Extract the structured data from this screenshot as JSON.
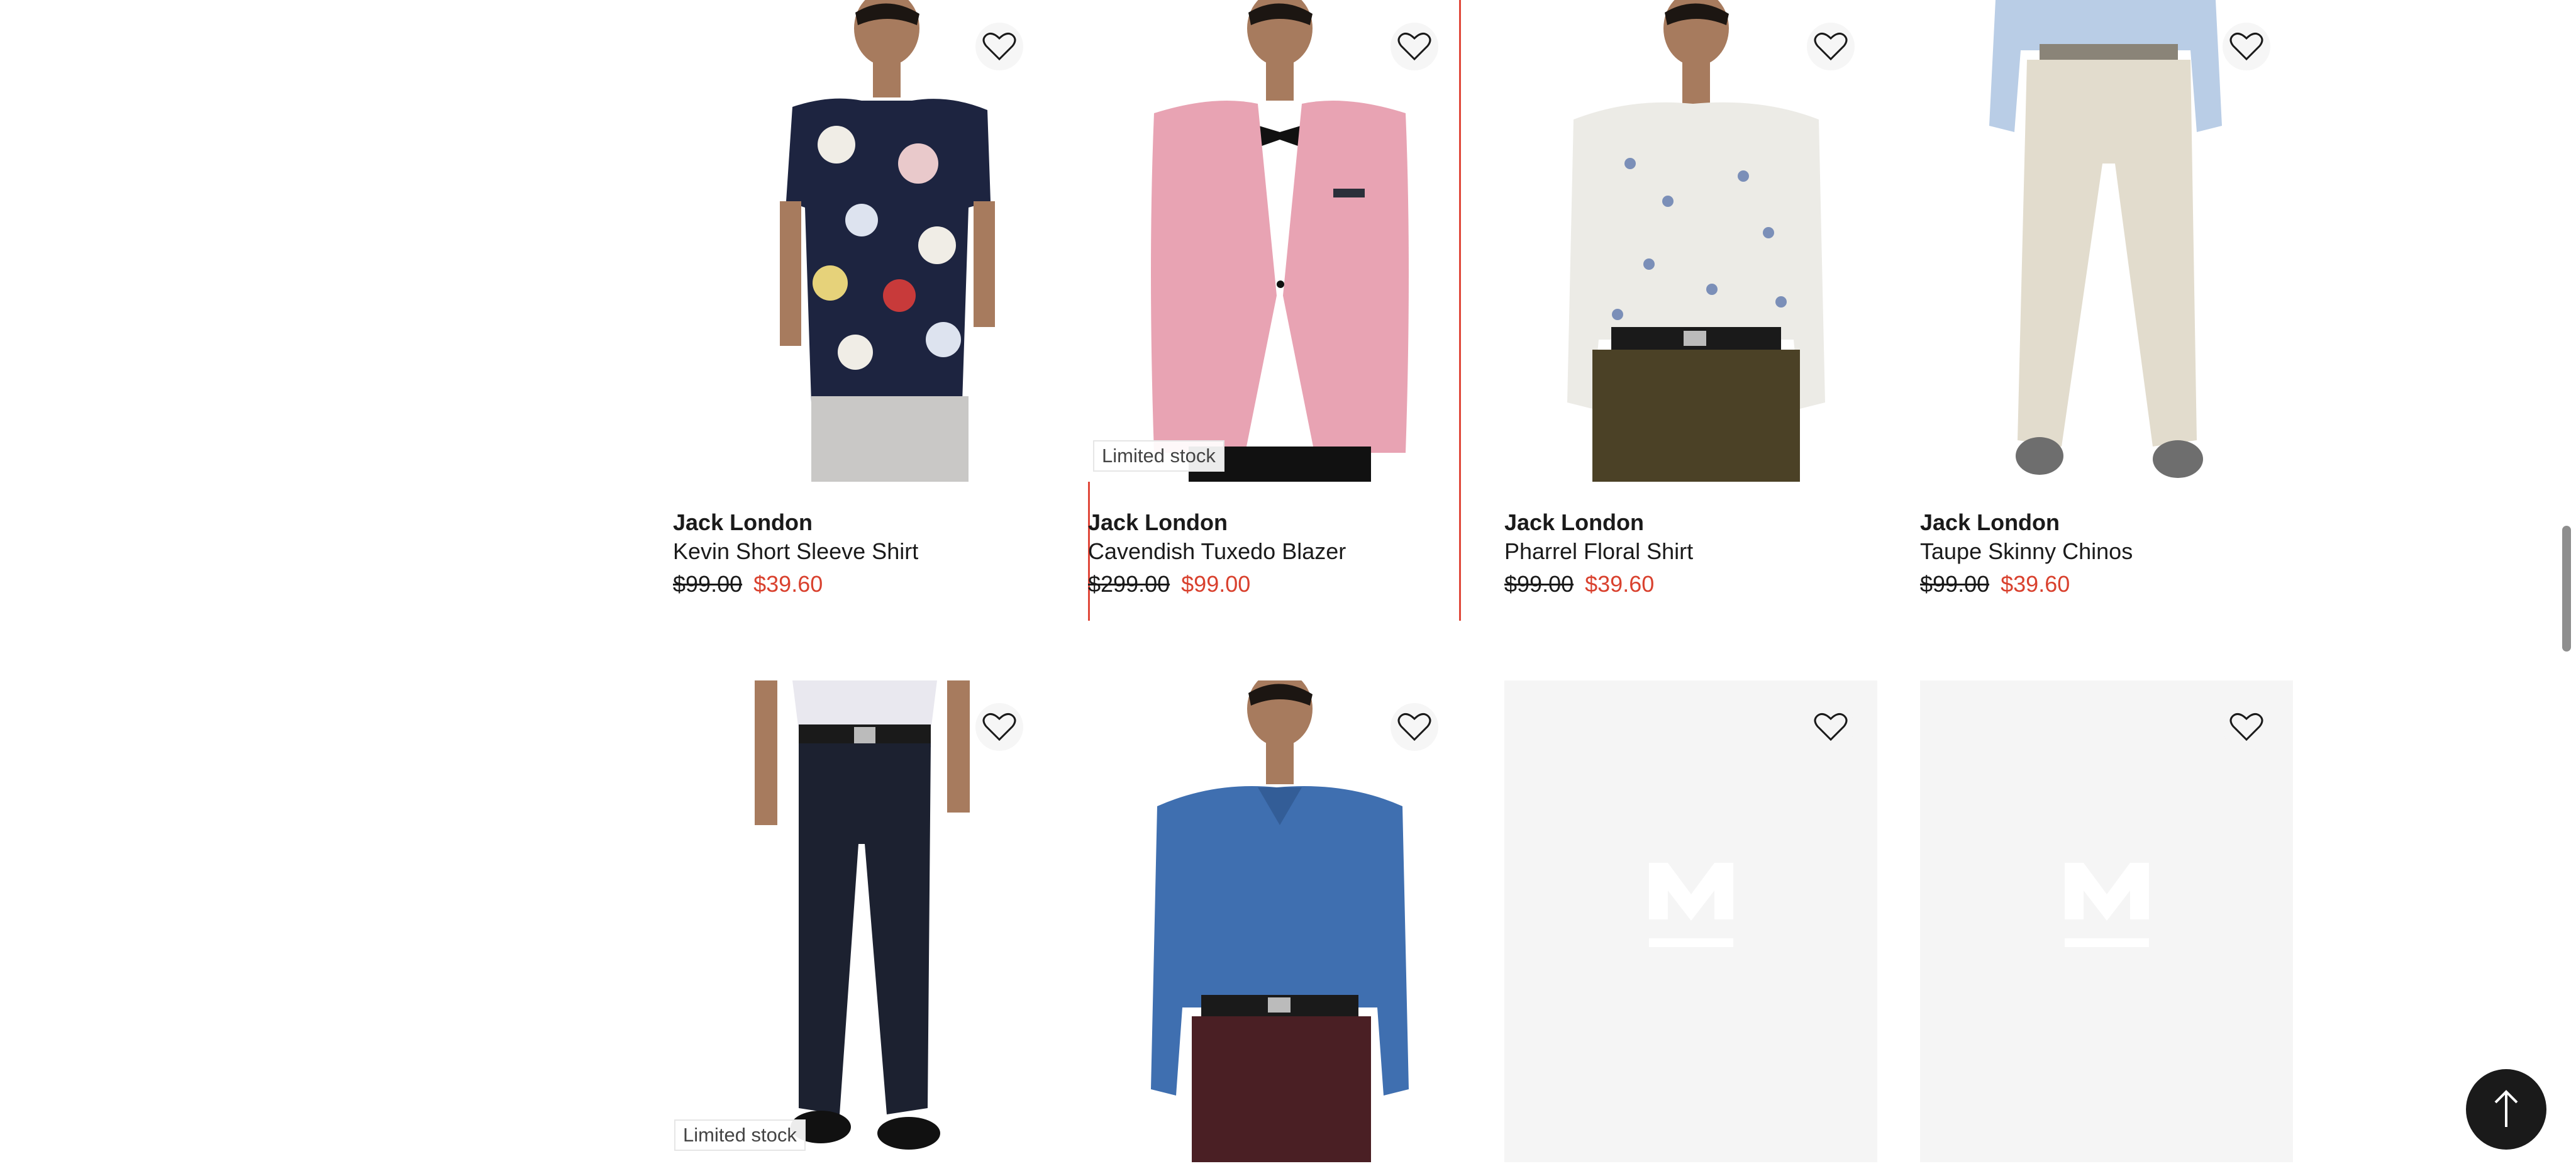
{
  "products": [
    {
      "brand": "Jack London",
      "name": "Kevin Short Sleeve Shirt",
      "was": "$99.00",
      "now": "$39.60",
      "badge": ""
    },
    {
      "brand": "Jack London",
      "name": "Cavendish Tuxedo Blazer",
      "was": "$299.00",
      "now": "$99.00",
      "badge": "Limited stock"
    },
    {
      "brand": "Jack London",
      "name": "Pharrel Floral Shirt",
      "was": "$99.00",
      "now": "$39.60",
      "badge": ""
    },
    {
      "brand": "Jack London",
      "name": "Taupe Skinny Chinos",
      "was": "$99.00",
      "now": "$39.60",
      "badge": ""
    },
    {
      "badge": "Limited stock"
    },
    {
      "badge": ""
    },
    {
      "badge": ""
    },
    {
      "badge": ""
    }
  ],
  "colors": {
    "sale_price": "#d9412e",
    "selected_outline": "#e0483a",
    "placeholder_bg": "#f5f5f5"
  },
  "icons": {
    "wishlist": "heart-icon",
    "back_to_top": "arrow-up-icon",
    "placeholder_logo": "m-logo-icon"
  }
}
